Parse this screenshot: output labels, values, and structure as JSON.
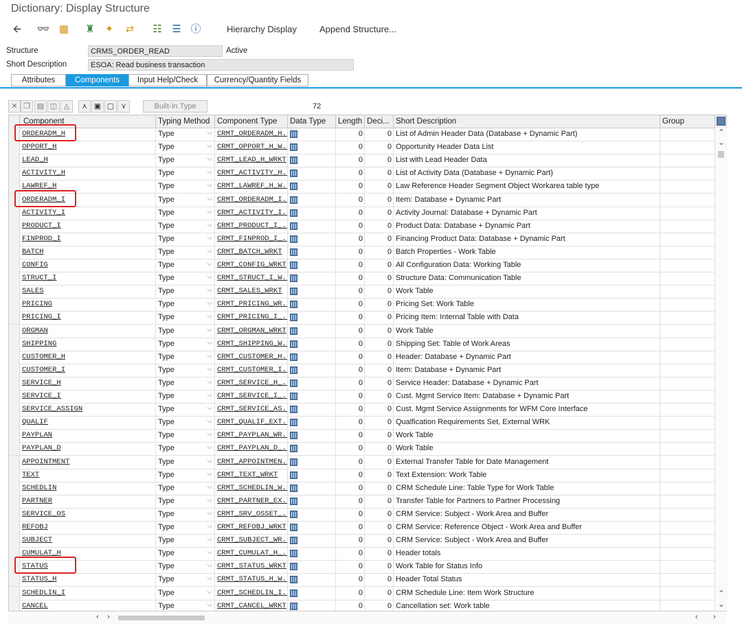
{
  "window": {
    "title": "Dictionary: Display Structure"
  },
  "toolbar": {
    "icons": [
      "back-icon",
      "glasses-icon",
      "clipboard-icon",
      "hierarchy-tools-icon",
      "magic-wand-icon",
      "where-used-icon",
      "org-structure-icon",
      "stack-icon",
      "info-icon"
    ],
    "hierarchy_display": "Hierarchy Display",
    "append_structure": "Append Structure..."
  },
  "header": {
    "structure_label": "Structure",
    "structure_value": "CRMS_ORDER_READ",
    "status": "Active",
    "short_desc_label": "Short Description",
    "short_desc_value": "ESOA: Read business transaction"
  },
  "tabs": [
    {
      "label": "Attributes",
      "active": false
    },
    {
      "label": "Components",
      "active": true
    },
    {
      "label": "Input Help/Check",
      "active": false
    },
    {
      "label": "Currency/Quantity Fields",
      "active": false
    }
  ],
  "grid_toolbar": {
    "builtin_type": "Built-In Type",
    "row_count": "72"
  },
  "columns": [
    "Component",
    "Typing Method",
    "Component Type",
    "Data Type",
    "Length",
    "Deci...",
    "Short Description",
    "Group"
  ],
  "rows": [
    {
      "component": "ORDERADM_H",
      "typing": "Type",
      "comp_type": "CRMT_ORDERADM_H...",
      "length": "0",
      "dec": "0",
      "desc": "List of Admin Header Data (Database + Dynamic Part)"
    },
    {
      "component": "OPPORT_H",
      "typing": "Type",
      "comp_type": "CRMT_OPPORT_H_W...",
      "length": "0",
      "dec": "0",
      "desc": "Opportunity Header Data List"
    },
    {
      "component": "LEAD_H",
      "typing": "Type",
      "comp_type": "CRMT_LEAD_H_WRKT",
      "length": "0",
      "dec": "0",
      "desc": "List with Lead Header Data"
    },
    {
      "component": "ACTIVITY_H",
      "typing": "Type",
      "comp_type": "CRMT_ACTIVITY_H...",
      "length": "0",
      "dec": "0",
      "desc": "List of Activity Data (Database + Dynamic Part)"
    },
    {
      "component": "LAWREF_H",
      "typing": "Type",
      "comp_type": "CRMT_LAWREF_H_W...",
      "length": "0",
      "dec": "0",
      "desc": "Law Reference Header Segment Object Workarea table type"
    },
    {
      "component": "ORDERADM_I",
      "typing": "Type",
      "comp_type": "CRMT_ORDERADM_I...",
      "length": "0",
      "dec": "0",
      "desc": "Item: Database + Dynamic Part"
    },
    {
      "component": "ACTIVITY_I",
      "typing": "Type",
      "comp_type": "CRMT_ACTIVITY_I...",
      "length": "0",
      "dec": "0",
      "desc": "Activity Journal: Database + Dynamic Part"
    },
    {
      "component": "PRODUCT_I",
      "typing": "Type",
      "comp_type": "CRMT_PRODUCT_I_...",
      "length": "0",
      "dec": "0",
      "desc": "Product Data: Database + Dynamic Part"
    },
    {
      "component": "FINPROD_I",
      "typing": "Type",
      "comp_type": "CRMT_FINPROD_I_...",
      "length": "0",
      "dec": "0",
      "desc": "Financing Product Data: Database + Dynamic Part"
    },
    {
      "component": "BATCH",
      "typing": "Type",
      "comp_type": "CRMT_BATCH_WRKT",
      "length": "0",
      "dec": "0",
      "desc": "Batch Properties - Work Table"
    },
    {
      "component": "CONFIG",
      "typing": "Type",
      "comp_type": "CRMT_CONFIG_WRKT",
      "length": "0",
      "dec": "0",
      "desc": "All Configuration Data: Working Table"
    },
    {
      "component": "STRUCT_I",
      "typing": "Type",
      "comp_type": "CRMT_STRUCT_I_W...",
      "length": "0",
      "dec": "0",
      "desc": "Structure Data: Communication Table"
    },
    {
      "component": "SALES",
      "typing": "Type",
      "comp_type": "CRMT_SALES_WRKT",
      "length": "0",
      "dec": "0",
      "desc": "Work Table"
    },
    {
      "component": "PRICING",
      "typing": "Type",
      "comp_type": "CRMT_PRICING_WR...",
      "length": "0",
      "dec": "0",
      "desc": "Pricing Set: Work Table"
    },
    {
      "component": "PRICING_I",
      "typing": "Type",
      "comp_type": "CRMT_PRICING_I_...",
      "length": "0",
      "dec": "0",
      "desc": "Pricing Item: Internal Table with Data"
    },
    {
      "component": "ORGMAN",
      "typing": "Type",
      "comp_type": "CRMT_ORGMAN_WRKT",
      "length": "0",
      "dec": "0",
      "desc": "Work Table"
    },
    {
      "component": "SHIPPING",
      "typing": "Type",
      "comp_type": "CRMT_SHIPPING_W...",
      "length": "0",
      "dec": "0",
      "desc": "Shipping Set: Table of Work Areas"
    },
    {
      "component": "CUSTOMER_H",
      "typing": "Type",
      "comp_type": "CRMT_CUSTOMER_H...",
      "length": "0",
      "dec": "0",
      "desc": "Header: Database + Dynamic Part"
    },
    {
      "component": "CUSTOMER_I",
      "typing": "Type",
      "comp_type": "CRMT_CUSTOMER_I...",
      "length": "0",
      "dec": "0",
      "desc": "Item: Database + Dynamic Part"
    },
    {
      "component": "SERVICE_H",
      "typing": "Type",
      "comp_type": "CRMT_SERVICE_H_...",
      "length": "0",
      "dec": "0",
      "desc": "Service Header: Database + Dynamic Part"
    },
    {
      "component": "SERVICE_I",
      "typing": "Type",
      "comp_type": "CRMT_SERVICE_I_...",
      "length": "0",
      "dec": "0",
      "desc": "Cust. Mgmt Service Item: Database + Dynamic Part"
    },
    {
      "component": "SERVICE_ASSIGN",
      "typing": "Type",
      "comp_type": "CRMT_SERVICE_AS...",
      "length": "0",
      "dec": "0",
      "desc": "Cust. Mgmt Service Assignments for WFM Core Interface"
    },
    {
      "component": "QUALIF",
      "typing": "Type",
      "comp_type": "CRMT_QUALIF_EXT...",
      "length": "0",
      "dec": "0",
      "desc": "Qualfication Requirements Set, External WRK"
    },
    {
      "component": "PAYPLAN",
      "typing": "Type",
      "comp_type": "CRMT_PAYPLAN_WR...",
      "length": "0",
      "dec": "0",
      "desc": "Work Table"
    },
    {
      "component": "PAYPLAN_D",
      "typing": "Type",
      "comp_type": "CRMT_PAYPLAN_D_...",
      "length": "0",
      "dec": "0",
      "desc": "Work Table"
    },
    {
      "component": "APPOINTMENT",
      "typing": "Type",
      "comp_type": "CRMT_APPOINTMEN...",
      "length": "0",
      "dec": "0",
      "desc": "External Transfer Table for Date Management"
    },
    {
      "component": "TEXT",
      "typing": "Type",
      "comp_type": "CRMT_TEXT_WRKT",
      "length": "0",
      "dec": "0",
      "desc": "Text Extension: Work Table"
    },
    {
      "component": "SCHEDLIN",
      "typing": "Type",
      "comp_type": "CRMT_SCHEDLIN_W...",
      "length": "0",
      "dec": "0",
      "desc": "CRM Schedule Line: Table Type for Work Table"
    },
    {
      "component": "PARTNER",
      "typing": "Type",
      "comp_type": "CRMT_PARTNER_EX...",
      "length": "0",
      "dec": "0",
      "desc": "Transfer Table for Partners to Partner Processing"
    },
    {
      "component": "SERVICE_OS",
      "typing": "Type",
      "comp_type": "CRMT_SRV_OSSET_...",
      "length": "0",
      "dec": "0",
      "desc": "CRM Service: Subject - Work Area and Buffer"
    },
    {
      "component": "REFOBJ",
      "typing": "Type",
      "comp_type": "CRMT_REFOBJ_WRKT",
      "length": "0",
      "dec": "0",
      "desc": "CRM Service: Reference Object - Work Area and Buffer"
    },
    {
      "component": "SUBJECT",
      "typing": "Type",
      "comp_type": "CRMT_SUBJECT_WR...",
      "length": "0",
      "dec": "0",
      "desc": "CRM Service: Subject - Work Area and Buffer"
    },
    {
      "component": "CUMULAT_H",
      "typing": "Type",
      "comp_type": "CRMT_CUMULAT_H_...",
      "length": "0",
      "dec": "0",
      "desc": "Header totals"
    },
    {
      "component": "STATUS",
      "typing": "Type",
      "comp_type": "CRMT_STATUS_WRKT",
      "length": "0",
      "dec": "0",
      "desc": "Work Table for Status Info"
    },
    {
      "component": "STATUS_H",
      "typing": "Type",
      "comp_type": "CRMT_STATUS_H_W...",
      "length": "0",
      "dec": "0",
      "desc": "Header Total Status"
    },
    {
      "component": "SCHEDLIN_I",
      "typing": "Type",
      "comp_type": "CRMT_SCHEDLIN_I...",
      "length": "0",
      "dec": "0",
      "desc": "CRM Schedule Line: Item Work Structure"
    },
    {
      "component": "CANCEL",
      "typing": "Type",
      "comp_type": "CRMT_CANCEL_WRKT",
      "length": "0",
      "dec": "0",
      "desc": "Cancellation set: Work table"
    }
  ],
  "highlighted_rows": [
    0,
    5,
    33
  ]
}
